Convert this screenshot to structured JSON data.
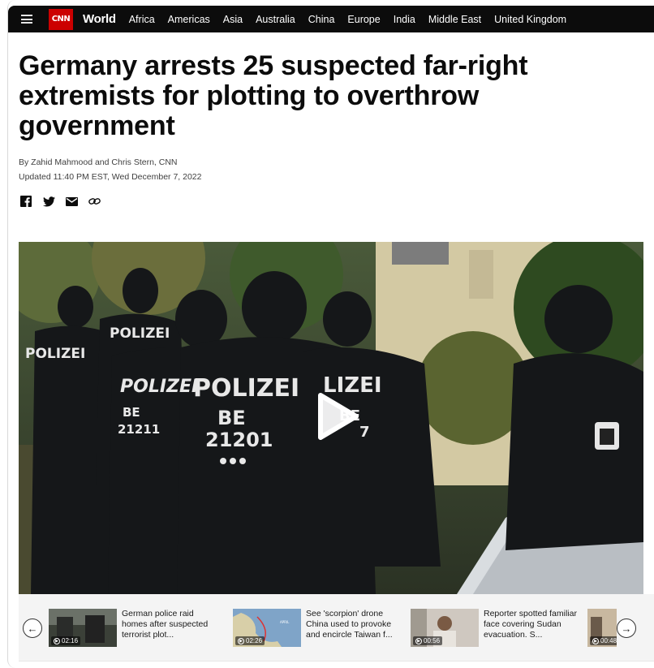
{
  "nav": {
    "logo": "CNN",
    "section": "World",
    "links": [
      "Africa",
      "Americas",
      "Asia",
      "Australia",
      "China",
      "Europe",
      "India",
      "Middle East",
      "United Kingdom"
    ]
  },
  "article": {
    "headline": "Germany arrests 25 suspected far-right extremists for plotting to overthrow government",
    "byline": "By Zahid Mahmood and Chris Stern, CNN",
    "updated": "Updated 11:40 PM EST, Wed December 7, 2022"
  },
  "share_icons": [
    "facebook-icon",
    "twitter-icon",
    "email-icon",
    "link-icon"
  ],
  "video": {
    "vest_labels": [
      "POLIZEI",
      "BE",
      "21201",
      "POLIZEI",
      "BE",
      "21211",
      "POLIZEI",
      "POLIZEI",
      "LIZEI",
      "BE",
      "7"
    ]
  },
  "carousel": {
    "items": [
      {
        "title": "German police raid homes after suspected terrorist plot...",
        "duration": "02:16"
      },
      {
        "title": "See 'scorpion' drone China used to provoke and encircle Taiwan f...",
        "duration": "02:26"
      },
      {
        "title": "Reporter spotted familiar face covering Sudan evacuation. S...",
        "duration": "00:56"
      },
      {
        "title": "",
        "duration": "00:48"
      }
    ]
  }
}
